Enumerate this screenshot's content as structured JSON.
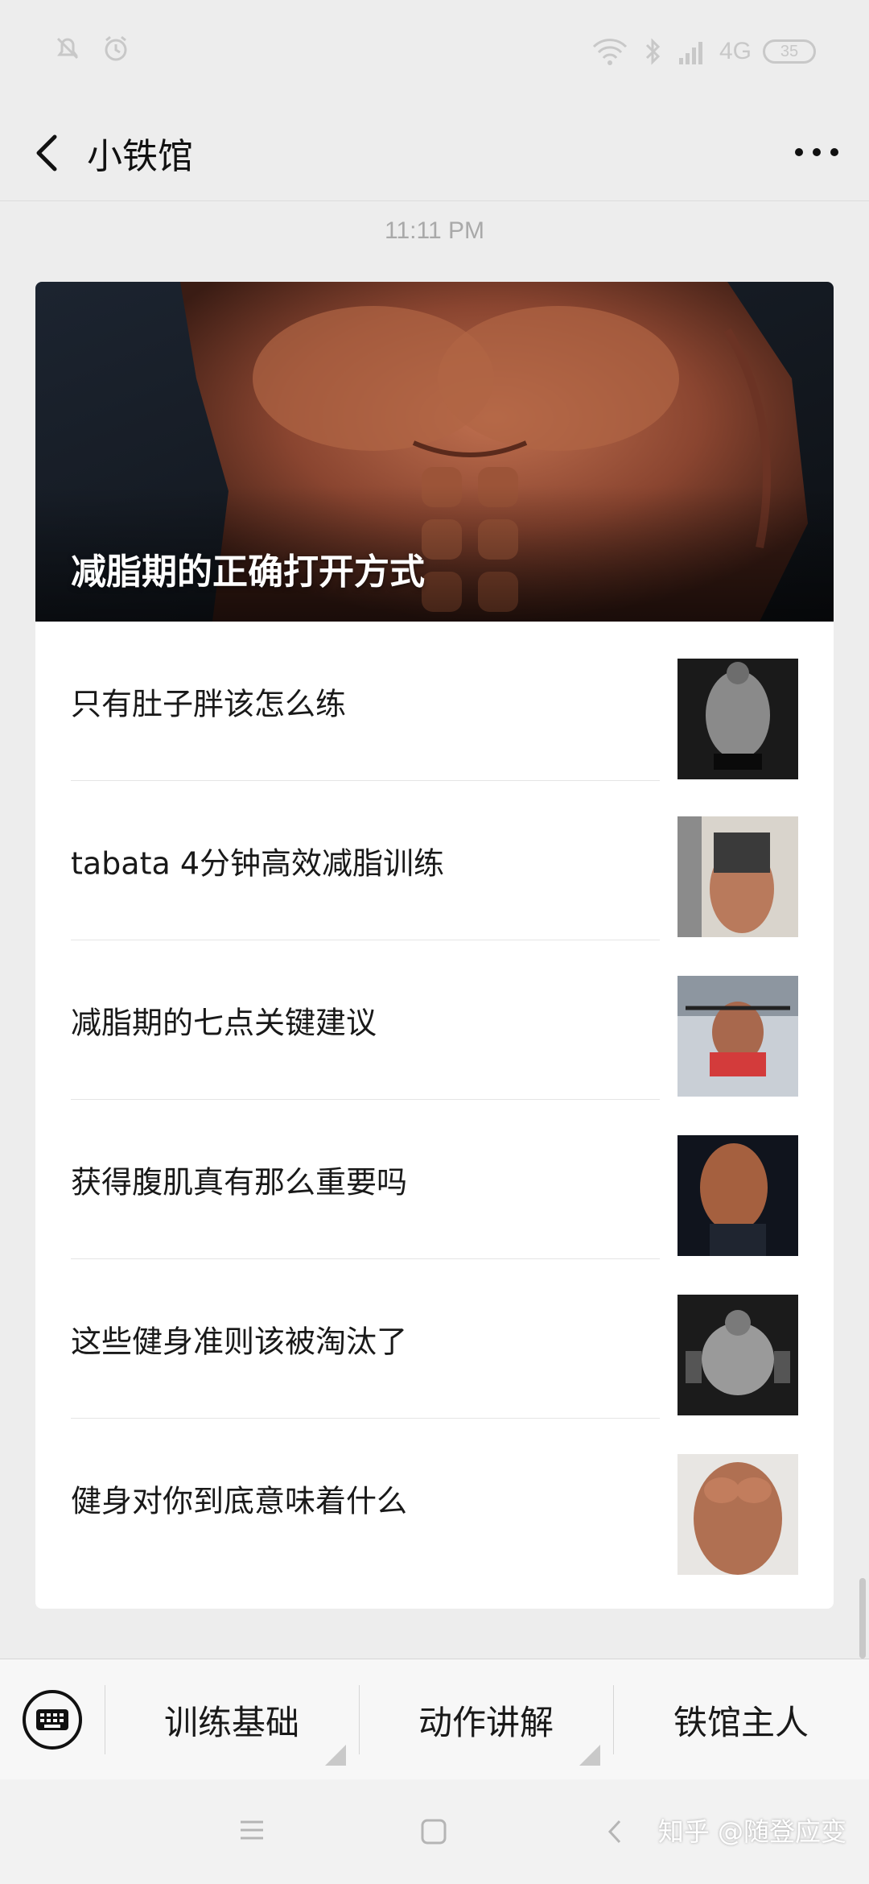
{
  "status_bar": {
    "network": "4G",
    "battery": "35"
  },
  "header": {
    "title": "小铁馆"
  },
  "timestamp": "11:11 PM",
  "card": {
    "hero_title": "减脂期的正确打开方式",
    "items": [
      {
        "title": "只有肚子胖该怎么练"
      },
      {
        "title": "tabata 4分钟高效减脂训练"
      },
      {
        "title": "减脂期的七点关键建议"
      },
      {
        "title": "获得腹肌真有那么重要吗"
      },
      {
        "title": "这些健身准则该被淘汰了"
      },
      {
        "title": "健身对你到底意味着什么"
      }
    ]
  },
  "menu": {
    "items": [
      {
        "label": "训练基础"
      },
      {
        "label": "动作讲解"
      },
      {
        "label": "铁馆主人"
      }
    ]
  },
  "watermark": "知乎 @随登应变"
}
